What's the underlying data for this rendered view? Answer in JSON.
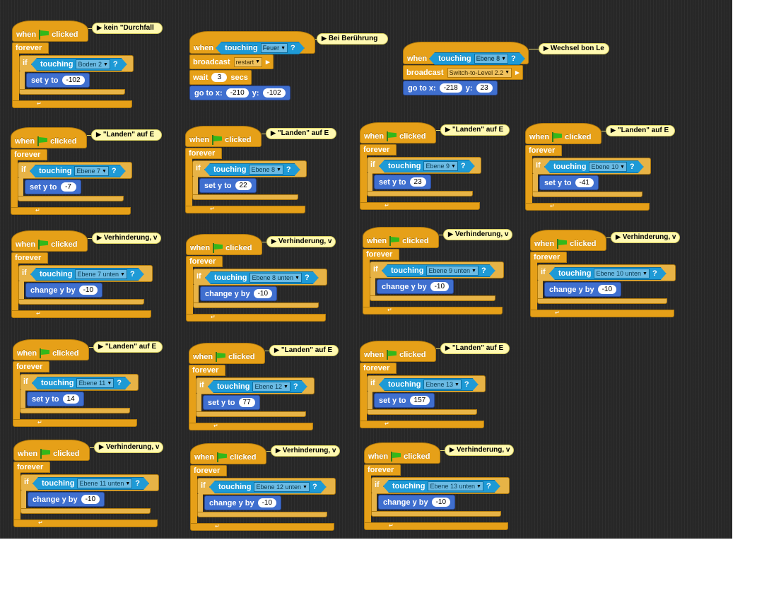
{
  "labels": {
    "when": "when",
    "clicked": "clicked",
    "forever": "forever",
    "if": "if",
    "touching": "touching",
    "set_y_to": "set y to",
    "change_y_by": "change y by",
    "broadcast": "broadcast",
    "wait": "wait",
    "secs": "secs",
    "go_to_x": "go to x:",
    "y": "y:",
    "q": "?"
  },
  "comments": {
    "durchfall": "kein \"Durchfall",
    "beruehrung": "Bei Berührung",
    "wechsel": "Wechsel bon Le",
    "landen": "\"Landen\" auf E",
    "verhinderung": "Verhinderung, v"
  },
  "touching_feuer": {
    "sprite": "Feuer",
    "broadcast": "restart",
    "wait": "3",
    "go_x": "-210",
    "go_y": "-102"
  },
  "touching_ebene8": {
    "sprite": "Ebene 8",
    "broadcast": "Switch-to-Level 2.2",
    "go_x": "-218",
    "go_y": "23"
  },
  "scripts": [
    {
      "kind": "set",
      "sprite": "Boden 2",
      "value": "-102",
      "comment": "durchfall"
    },
    {
      "kind": "set",
      "sprite": "Ebene 7",
      "value": "-7",
      "comment": "landen"
    },
    {
      "kind": "set",
      "sprite": "Ebene 8",
      "value": "22",
      "comment": "landen"
    },
    {
      "kind": "set",
      "sprite": "Ebene 9",
      "value": "23",
      "comment": "landen"
    },
    {
      "kind": "set",
      "sprite": "Ebene 10",
      "value": "-41",
      "comment": "landen"
    },
    {
      "kind": "change",
      "sprite": "Ebene 7 unten",
      "value": "-10",
      "comment": "verhinderung"
    },
    {
      "kind": "change",
      "sprite": "Ebene 8 unten",
      "value": "-10",
      "comment": "verhinderung"
    },
    {
      "kind": "change",
      "sprite": "Ebene 9 unten",
      "value": "-10",
      "comment": "verhinderung"
    },
    {
      "kind": "change",
      "sprite": "Ebene 10 unten",
      "value": "-10",
      "comment": "verhinderung"
    },
    {
      "kind": "set",
      "sprite": "Ebene 11",
      "value": "14",
      "comment": "landen"
    },
    {
      "kind": "set",
      "sprite": "Ebene 12",
      "value": "77",
      "comment": "landen"
    },
    {
      "kind": "set",
      "sprite": "Ebene 13",
      "value": "157",
      "comment": "landen"
    },
    {
      "kind": "change",
      "sprite": "Ebene 11 unten",
      "value": "-10",
      "comment": "verhinderung"
    },
    {
      "kind": "change",
      "sprite": "Ebene 12 unten",
      "value": "-10",
      "comment": "verhinderung"
    },
    {
      "kind": "change",
      "sprite": "Ebene 13 unten",
      "value": "-10",
      "comment": "verhinderung"
    }
  ]
}
